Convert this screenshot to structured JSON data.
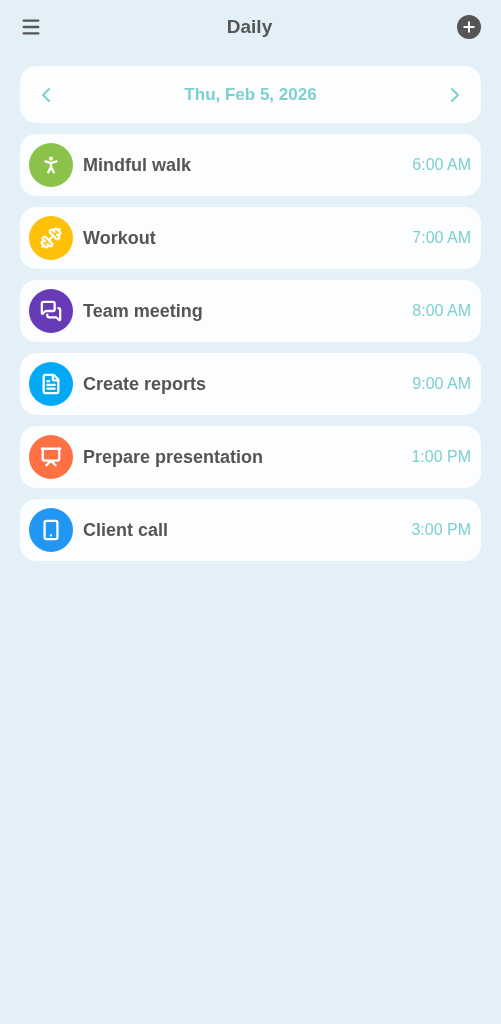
{
  "header": {
    "title": "Daily"
  },
  "date_bar": {
    "label": "Thu, Feb 5, 2026"
  },
  "events": [
    {
      "kind": "walk",
      "title": "Mindful walk",
      "time": "6:00 AM",
      "color": "#8bc34a"
    },
    {
      "kind": "workout",
      "title": "Workout",
      "time": "7:00 AM",
      "color": "#ffc107"
    },
    {
      "kind": "meeting",
      "title": "Team meeting",
      "time": "8:00 AM",
      "color": "#673ab7"
    },
    {
      "kind": "report",
      "title": "Create reports",
      "time": "9:00 AM",
      "color": "#03a9f4"
    },
    {
      "kind": "presentation",
      "title": "Prepare presentation",
      "time": "1:00 PM",
      "color": "#ff7043"
    },
    {
      "kind": "phone",
      "title": "Client call",
      "time": "3:00 PM",
      "color": "#2196f3"
    }
  ]
}
